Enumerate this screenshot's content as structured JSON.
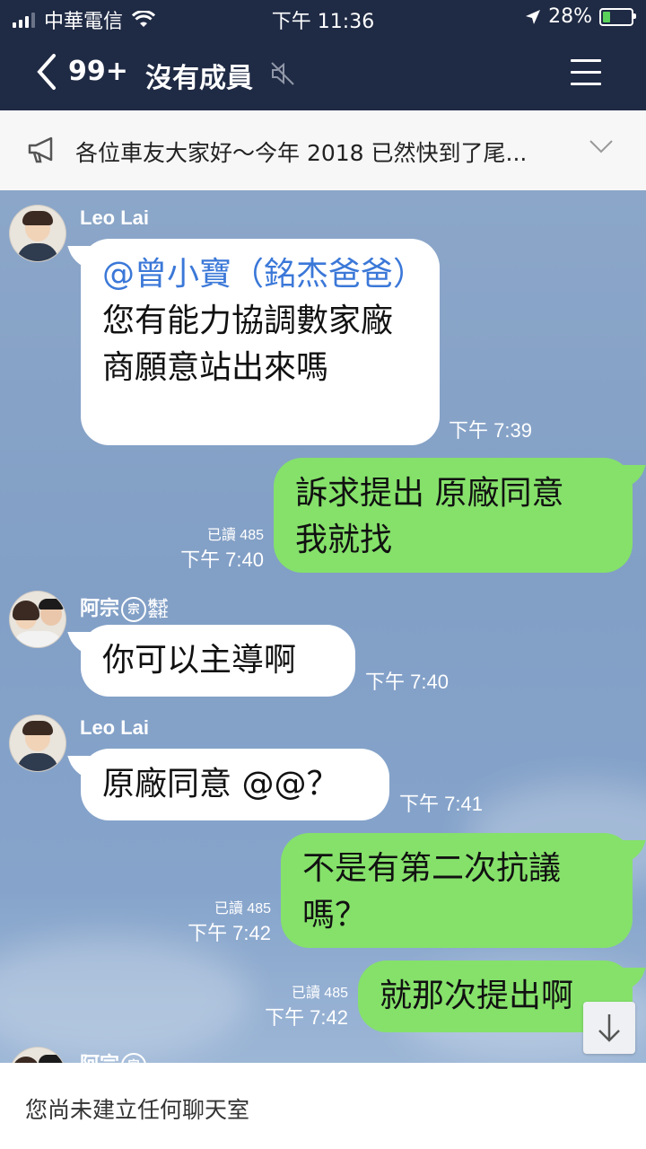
{
  "status": {
    "carrier": "中華電信",
    "time": "下午 11:36",
    "battery": "28%",
    "battery_level": 0.28
  },
  "header": {
    "back_count": "99+",
    "title": "沒有成員"
  },
  "announcement": {
    "text": "各位車友大家好～今年 2018 已然快到了尾..."
  },
  "messages": {
    "m1": {
      "sender": "Leo Lai",
      "mention": "@曾小寶（銘杰爸爸）",
      "text": "您有能力協調數家廠商願意站出來嗎",
      "time": "下午 7:39"
    },
    "m2": {
      "text_line1": "訴求提出 原廠同意",
      "text_line2": "我就找",
      "read": "已讀 485",
      "time": "下午 7:40"
    },
    "m3": {
      "sender": "阿宗",
      "badge": "宗",
      "badge_small": "株式会社",
      "text": "你可以主導啊",
      "time": "下午 7:40"
    },
    "m4": {
      "sender": "Leo Lai",
      "text": "原廠同意 @@？",
      "time": "下午 7:41"
    },
    "m5": {
      "text_line1": "不是有第二次抗議",
      "text_line2": "嗎？",
      "read": "已讀 485",
      "time": "下午 7:42"
    },
    "m6": {
      "text": "就那次提出啊",
      "read": "已讀 485",
      "time": "下午 7:42"
    },
    "m7": {
      "sender": "阿宗",
      "badge": "宗"
    }
  },
  "bottom": {
    "message": "您尚未建立任何聊天室"
  }
}
